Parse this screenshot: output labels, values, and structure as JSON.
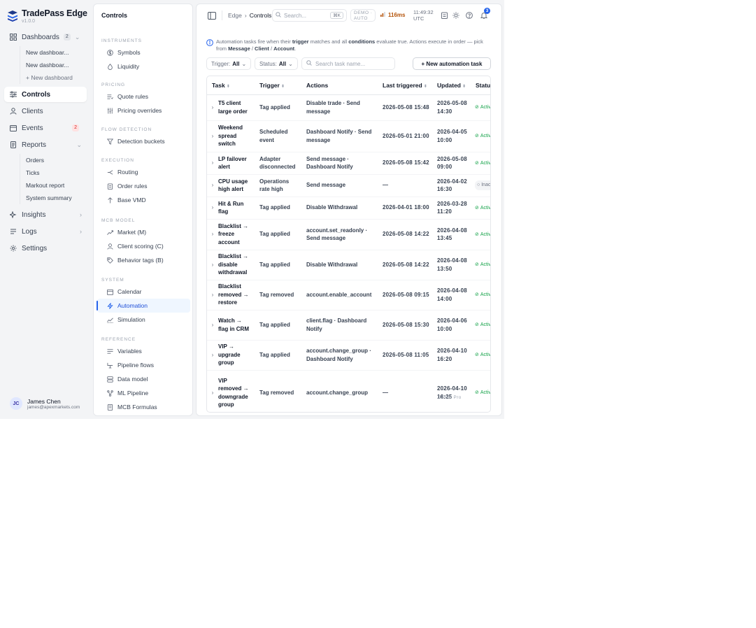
{
  "brand": {
    "name": "TradePass Edge",
    "version": "v1.0.0"
  },
  "nav": {
    "dashboards": {
      "label": "Dashboards",
      "badge": "2",
      "subitems": [
        "New dashboar...",
        "New dashboar...",
        "+ New dashboard"
      ]
    },
    "controls": {
      "label": "Controls"
    },
    "clients": {
      "label": "Clients"
    },
    "events": {
      "label": "Events",
      "badge": "2"
    },
    "reports": {
      "label": "Reports",
      "subitems": [
        "Orders",
        "Ticks",
        "Markout report",
        "System summary"
      ]
    },
    "insights": {
      "label": "Insights"
    },
    "logs": {
      "label": "Logs"
    },
    "settings": {
      "label": "Settings"
    }
  },
  "user": {
    "initials": "JC",
    "name": "James Chen",
    "email": "james@apexmarkets.com"
  },
  "panel": {
    "title": "Controls",
    "sections": [
      {
        "heading": "INSTRUMENTS",
        "items": [
          "Symbols",
          "Liquidity"
        ]
      },
      {
        "heading": "PRICING",
        "items": [
          "Quote rules",
          "Pricing overrides"
        ]
      },
      {
        "heading": "FLOW DETECTION",
        "items": [
          "Detection buckets"
        ]
      },
      {
        "heading": "EXECUTION",
        "items": [
          "Routing",
          "Order rules",
          "Base VMD"
        ]
      },
      {
        "heading": "MCB MODEL",
        "items": [
          "Market (M)",
          "Client scoring (C)",
          "Behavior tags (B)"
        ]
      },
      {
        "heading": "SYSTEM",
        "items": [
          "Calendar",
          "Automation",
          "Simulation"
        ]
      },
      {
        "heading": "REFERENCE",
        "items": [
          "Variables",
          "Pipeline flows",
          "Data model",
          "ML Pipeline",
          "MCB Formulas"
        ]
      }
    ]
  },
  "topbar": {
    "crumb_root": "Edge",
    "crumb_current": "Controls",
    "search_placeholder": "Search...",
    "search_kbd": "⌘K",
    "mode_line1": "DEMO ·",
    "mode_line2": "AUTO",
    "latency": "116ms",
    "time": "11:49:32",
    "timezone": "UTC",
    "notifications": "3"
  },
  "info": {
    "p1": "Automation tasks fire when their ",
    "b1": "trigger",
    "p2": " matches and all ",
    "b2": "conditions",
    "p3": " evaluate true. Actions execute in order — pick from ",
    "b3": "Message",
    "p4": " / ",
    "b4": "Client",
    "p5": " / ",
    "b5": "Account",
    "p6": "."
  },
  "filters": {
    "trigger_label": "Trigger:",
    "trigger_value": "All",
    "status_label": "Status:",
    "status_value": "All",
    "search_placeholder": "Search task name...",
    "new_button": "+ New automation task"
  },
  "table": {
    "headers": [
      "Task",
      "Trigger",
      "Actions",
      "Last triggered",
      "Updated",
      "Status"
    ],
    "rows": [
      {
        "task": "T5 client large order",
        "trigger": "Tag applied",
        "actions": "Disable trade · Send message",
        "last": "2026-05-08 15:48",
        "updated": "2026-05-08 14:30",
        "status": "Active"
      },
      {
        "task": "Weekend spread switch",
        "trigger": "Scheduled event",
        "actions": "Dashboard Notify · Send message",
        "last": "2026-05-01 21:00",
        "updated": "2026-04-05 10:00",
        "status": "Active"
      },
      {
        "task": "LP failover alert",
        "trigger": "Adapter disconnected",
        "actions": "Send message · Dashboard Notify",
        "last": "2026-05-08 15:42",
        "updated": "2026-05-08 09:00",
        "status": "Active"
      },
      {
        "task": "CPU usage high alert",
        "trigger": "Operations rate high",
        "actions": "Send message",
        "last": "—",
        "updated": "2026-04-02 16:30",
        "status": "Inactive"
      },
      {
        "task": "Hit & Run flag",
        "trigger": "Tag applied",
        "actions": "Disable Withdrawal",
        "last": "2026-04-01 18:00",
        "updated": "2026-03-28 11:20",
        "status": "Active"
      },
      {
        "task": "Blacklist → freeze account",
        "trigger": "Tag applied",
        "actions": "account.set_readonly · Send message",
        "last": "2026-05-08 14:22",
        "updated": "2026-04-08 13:45",
        "status": "Active"
      },
      {
        "task": "Blacklist → disable withdrawal",
        "trigger": "Tag applied",
        "actions": "Disable Withdrawal",
        "last": "2026-05-08 14:22",
        "updated": "2026-04-08 13:50",
        "status": "Active"
      },
      {
        "task": "Blacklist removed → restore",
        "trigger": "Tag removed",
        "actions": "account.enable_account",
        "last": "2026-05-08 09:15",
        "updated": "2026-04-08 14:00",
        "status": "Active"
      },
      {
        "task": "Watch → flag in CRM",
        "trigger": "Tag applied",
        "actions": "client.flag · Dashboard Notify",
        "last": "2026-05-08 15:30",
        "updated": "2026-04-06 10:00",
        "status": "Active"
      },
      {
        "task": "VIP → upgrade group",
        "trigger": "Tag applied",
        "actions": "account.change_group · Dashboard Notify",
        "last": "2026-05-08 11:05",
        "updated": "2026-04-10 16:20",
        "status": "Active"
      },
      {
        "task": "VIP removed → downgrade group",
        "trigger": "Tag removed",
        "actions": "account.change_group",
        "last": "—",
        "updated": "2026-04-10 16:25",
        "status": "Active"
      }
    ]
  },
  "watermark": "DEMO Pro",
  "colors": {
    "accent": "#2563eb",
    "active_status": "#16a34a",
    "latency": "#b45309"
  }
}
